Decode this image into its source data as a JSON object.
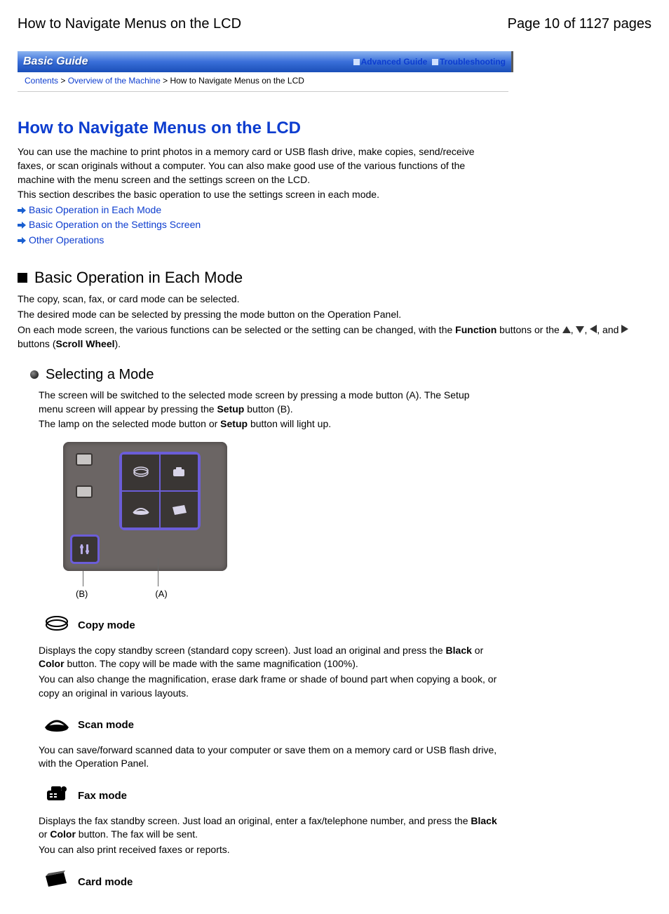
{
  "header": {
    "title": "How to Navigate Menus on the LCD",
    "page_info": "Page 10 of 1127 pages"
  },
  "banner": {
    "title": "Basic Guide",
    "links": {
      "advanced": "Advanced Guide",
      "troubleshooting": "Troubleshooting"
    }
  },
  "breadcrumb": {
    "contents": "Contents",
    "sep1": " > ",
    "overview": "Overview of the Machine",
    "sep2": "  > ",
    "current": "How to Navigate Menus on the LCD"
  },
  "page_title": "How to Navigate Menus on the LCD",
  "intro": {
    "p1": "You can use the machine to print photos in a memory card or USB flash drive, make copies, send/receive faxes, or scan originals without a computer. You can also make good use of the various functions of the machine with the menu screen and the settings screen on the LCD.",
    "p2": "This section describes the basic operation to use the settings screen in each mode."
  },
  "anchors": {
    "a1": "Basic Operation in Each Mode",
    "a2": "Basic Operation on the Settings Screen",
    "a3": "Other Operations"
  },
  "section1": {
    "heading": "Basic Operation in Each Mode",
    "p1": "The copy, scan, fax, or card mode can be selected.",
    "p2": "The desired mode can be selected by pressing the mode button on the Operation Panel.",
    "p3a": "On each mode screen, the various functions can be selected or the setting can be changed, with the ",
    "function": "Function",
    "p3b": " buttons or the ",
    "p3c": ", ",
    "p3d": ", ",
    "p3e": ", and ",
    "p3f": " buttons (",
    "scrollwheel": "Scroll Wheel",
    "p3g": ")."
  },
  "subsection_selecting": {
    "heading": "Selecting a Mode",
    "p1": "The screen will be switched to the selected mode screen by pressing a mode button (A). The Setup menu screen will appear by pressing the ",
    "setup1": "Setup",
    "p1b": " button (B).",
    "p2a": "The lamp on the selected mode button or ",
    "setup2": "Setup",
    "p2b": " button will light up."
  },
  "callouts": {
    "b": "(B)",
    "a": "(A)"
  },
  "modes": {
    "copy": {
      "label": "Copy mode",
      "p1a": "Displays the copy standby screen (standard copy screen). Just load an original and press the ",
      "black": "Black",
      "or1": " or ",
      "color": "Color",
      "p1b": " button. The copy will be made with the same magnification (100%).",
      "p2": "You can also change the magnification, erase dark frame or shade of bound part when copying a book, or copy an original in various layouts."
    },
    "scan": {
      "label": "Scan mode",
      "p1": "You can save/forward scanned data to your computer or save them on a memory card or USB flash drive, with the Operation Panel."
    },
    "fax": {
      "label": "Fax mode",
      "p1a": "Displays the fax standby screen. Just load an original, enter a fax/telephone number, and press the ",
      "black": "Black",
      "or1": " or ",
      "color": "Color",
      "p1b": " button. The fax will be sent.",
      "p2": "You can also print received faxes or reports."
    },
    "card": {
      "label": "Card mode"
    }
  }
}
